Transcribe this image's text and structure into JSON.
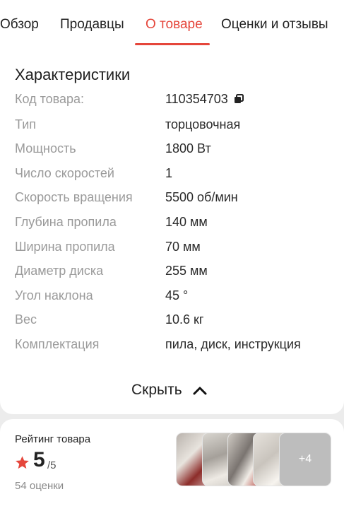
{
  "tabs": [
    {
      "label": "Обзор",
      "active": false
    },
    {
      "label": "Продавцы",
      "active": false
    },
    {
      "label": "О товаре",
      "active": true
    },
    {
      "label": "Оценки и отзывы",
      "active": false
    }
  ],
  "specs": {
    "title": "Характеристики",
    "rows": [
      {
        "label": "Код товара:",
        "value": "110354703"
      },
      {
        "label": "Тип",
        "value": "торцовочная"
      },
      {
        "label": "Мощность",
        "value": "1800 Вт"
      },
      {
        "label": "Число скоростей",
        "value": "1"
      },
      {
        "label": "Скорость вращения",
        "value": "5500 об/мин"
      },
      {
        "label": "Глубина пропила",
        "value": "140 мм"
      },
      {
        "label": "Ширина пропила",
        "value": "70 мм"
      },
      {
        "label": "Диаметр диска",
        "value": "255 мм"
      },
      {
        "label": "Угол наклона",
        "value": "45 °"
      },
      {
        "label": "Вес",
        "value": "10.6 кг"
      },
      {
        "label": "Комплектация",
        "value": "пила, диск, инструкция"
      }
    ],
    "collapse_label": "Скрыть"
  },
  "rating": {
    "title": "Рейтинг товара",
    "value": "5",
    "max": "/5",
    "count": "54 оценки",
    "more_photos": "+4"
  },
  "colors": {
    "accent": "#e5463b",
    "label_gray": "#9a9a9a",
    "background": "#ececec"
  },
  "icons": [
    "copy-icon",
    "chevron-up-icon",
    "star-icon"
  ]
}
